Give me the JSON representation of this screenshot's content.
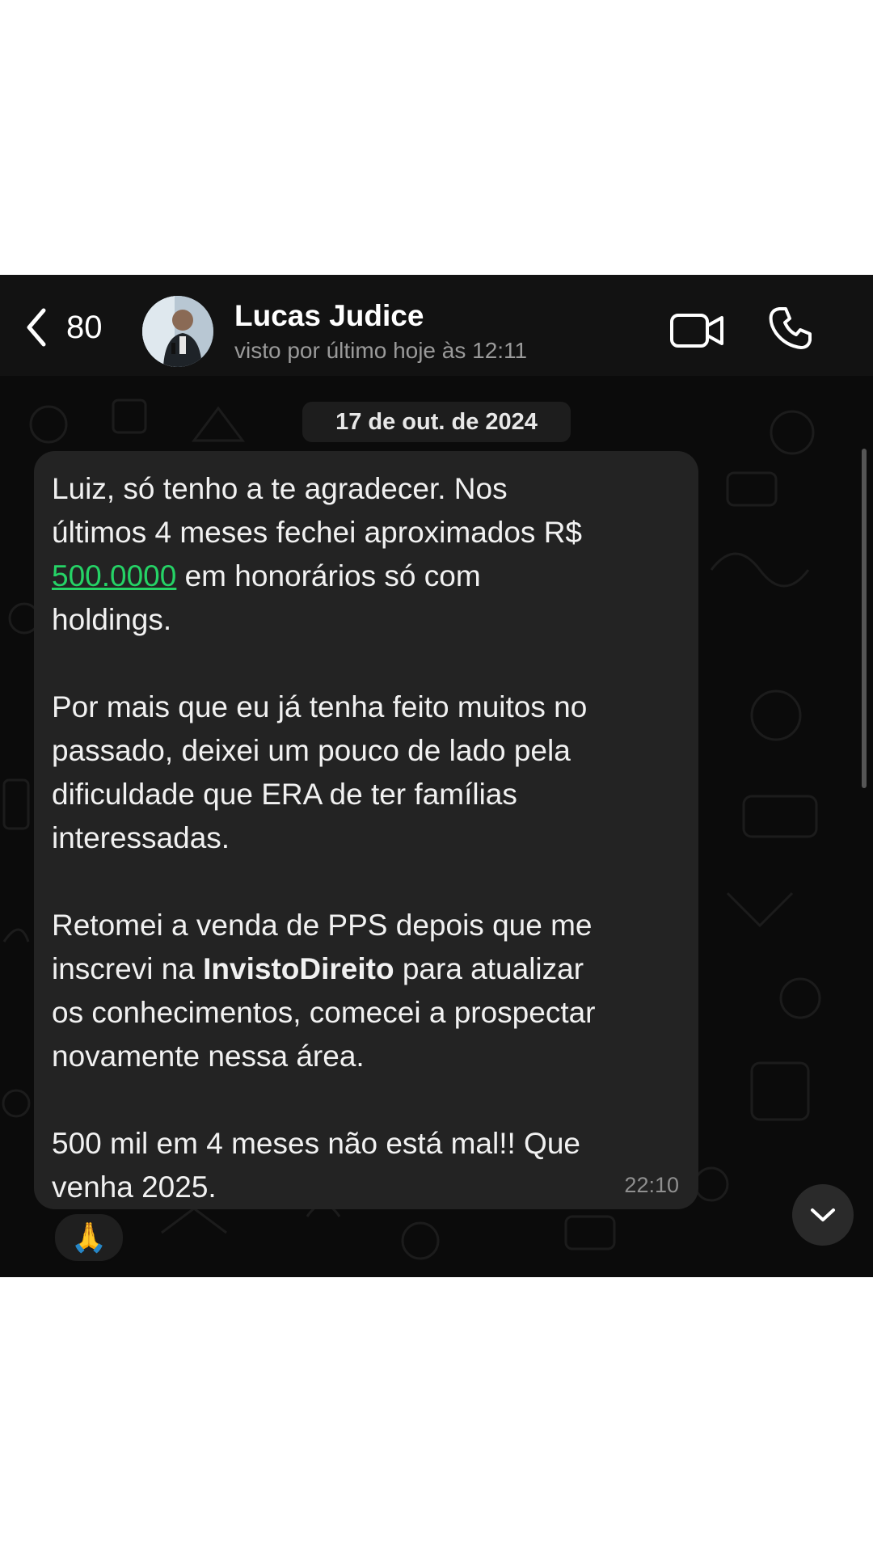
{
  "header": {
    "back_count": "80",
    "contact_name": "Lucas Judice",
    "contact_status": "visto por último hoje às 12:11"
  },
  "chat": {
    "date_label": "17 de out. de 2024",
    "message": {
      "line1": "Luiz, só tenho a te agradecer. Nos\núltimos 4 meses fechei aproximados R$\n",
      "amount": "500.0000",
      "line2": " em honorários só com\nholdings.\n\nPor mais que eu já tenha feito muitos no\npassado, deixei um pouco de lado pela\ndificuldade que ERA de ter famílias\ninteressadas.\n\nRetomei a venda de PPS depois que me\ninscrevi na ",
      "brand": "InvistoDireito",
      "line3": " para atualizar\nos conhecimentos, comecei a prospectar\nnovamente nessa área.\n\n500 mil em 4 meses não está mal!! Que\nvenha 2025.",
      "time": "22:10",
      "reaction": "🙏"
    }
  },
  "colors": {
    "background": "#0b0b0b",
    "header": "#121212",
    "bubble": "#232323",
    "link_green": "#25d366"
  }
}
